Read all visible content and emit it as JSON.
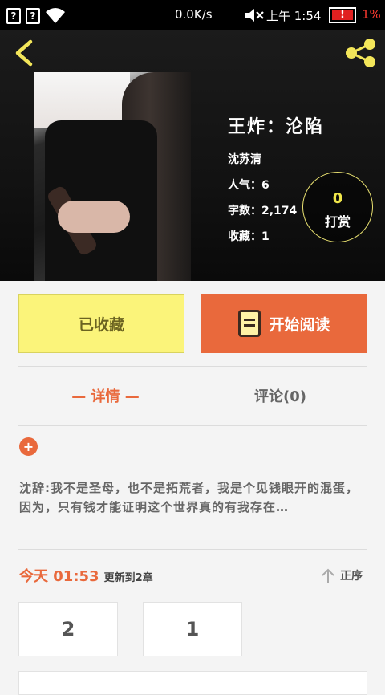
{
  "status_bar": {
    "sim1": "?",
    "sim2": "?",
    "net_speed": "0.0K/s",
    "time": "上午 1:54",
    "battery_alert": "!",
    "battery_pct": "1%"
  },
  "book": {
    "title": "王炸：沦陷",
    "author": "沈苏清",
    "popularity": "人气：6",
    "words": "字数：2,174",
    "favorites": "收藏：1",
    "tip_count": "0",
    "tip_label": "打赏"
  },
  "actions": {
    "favorite_label": "已收藏",
    "read_label": "开始阅读"
  },
  "tabs": {
    "detail": "— 详情 —",
    "comments": "评论(0)"
  },
  "description": {
    "expand_symbol": "+",
    "text": "沈辞:我不是圣母，也不是拓荒者，我是个见钱眼开的混蛋，因为，只有钱才能证明这个世界真的有我存在…"
  },
  "update": {
    "when": "今天 01:53",
    "text": "更新到2章",
    "order_label": "正序"
  },
  "chapters": [
    {
      "label": "2"
    },
    {
      "label": "1"
    }
  ],
  "colors": {
    "accent": "#e9693c",
    "favorite_bg": "#fbf47a",
    "tip_number": "#f0e64a"
  }
}
